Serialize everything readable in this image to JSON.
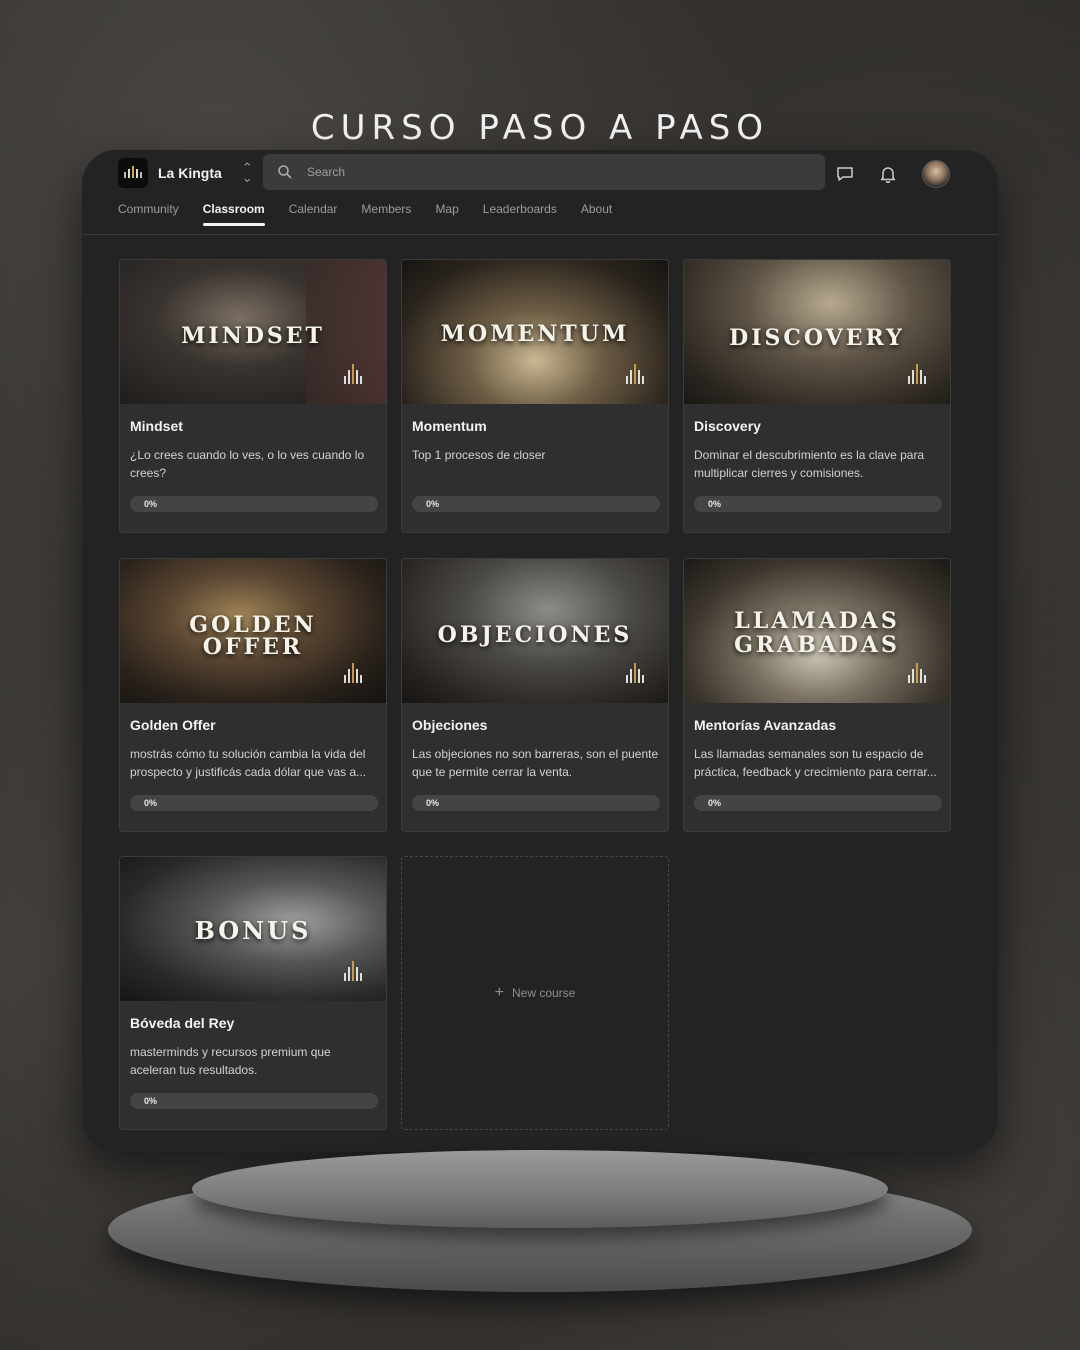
{
  "hero": {
    "title": "CURSO PASO A PASO"
  },
  "header": {
    "brand_name": "La Kingta",
    "search_placeholder": "Search",
    "icons": [
      "chat-icon",
      "bell-icon",
      "avatar"
    ]
  },
  "nav": {
    "items": [
      "Community",
      "Classroom",
      "Calendar",
      "Members",
      "Map",
      "Leaderboards",
      "About"
    ],
    "active": "Classroom"
  },
  "courses": [
    {
      "thumb_word": "MINDSET",
      "title": "Mindset",
      "description": "¿Lo crees cuando lo ves, o lo ves cuando lo crees?",
      "progress": "0%"
    },
    {
      "thumb_word": "MOMENTUM",
      "title": "Momentum",
      "description": "Top 1 procesos de closer",
      "progress": "0%"
    },
    {
      "thumb_word": "DISCOVERY",
      "title": "Discovery",
      "description": "Dominar el descubrimiento es la clave para multiplicar cierres y comisiones.",
      "progress": "0%"
    },
    {
      "thumb_word_line1": "GOLDEN",
      "thumb_word_line2": "OFFER",
      "title": "Golden Offer",
      "description": "mostrás cómo tu solución cambia la vida del prospecto y justificás cada dólar que vas a...",
      "progress": "0%"
    },
    {
      "thumb_word": "OBJECIONES",
      "title": "Objeciones",
      "description": "Las objeciones no son barreras, son el puente que te permite cerrar la venta.",
      "progress": "0%"
    },
    {
      "thumb_word_line1": "LLAMADAS",
      "thumb_word_line2": "GRABADAS",
      "title": "Mentorías Avanzadas",
      "description": "Las llamadas semanales son tu espacio de práctica, feedback y crecimiento para cerrar...",
      "progress": "0%"
    },
    {
      "thumb_word": "BONUS",
      "title": "Bóveda del Rey",
      "description": "masterminds y recursos premium que aceleran tus resultados.",
      "progress": "0%"
    }
  ],
  "new_course": {
    "label": "New course"
  }
}
